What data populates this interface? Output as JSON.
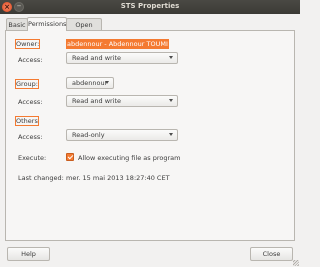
{
  "window": {
    "title": "STS Properties"
  },
  "tabs": [
    {
      "label": "Basic"
    },
    {
      "label": "Permissions"
    },
    {
      "label": "Open With"
    }
  ],
  "owner": {
    "label": "Owner:",
    "value": "abdennour - Abdennour TOUMI",
    "access_label": "Access:",
    "access_value": "Read and write"
  },
  "group": {
    "label": "Group:",
    "value": "abdennour",
    "access_label": "Access:",
    "access_value": "Read and write"
  },
  "others": {
    "label": "Others",
    "access_label": "Access:",
    "access_value": "Read-only"
  },
  "execute": {
    "label": "Execute:",
    "checkbox_label": "Allow executing file as program",
    "checked": true
  },
  "last_changed": {
    "label": "Last changed:",
    "value": "mer. 15 mai 2013 18:27:40 CET"
  },
  "buttons": {
    "help": "Help",
    "close": "Close"
  },
  "colors": {
    "accent": "#f47a31",
    "titlebar": "#3c3b37"
  }
}
